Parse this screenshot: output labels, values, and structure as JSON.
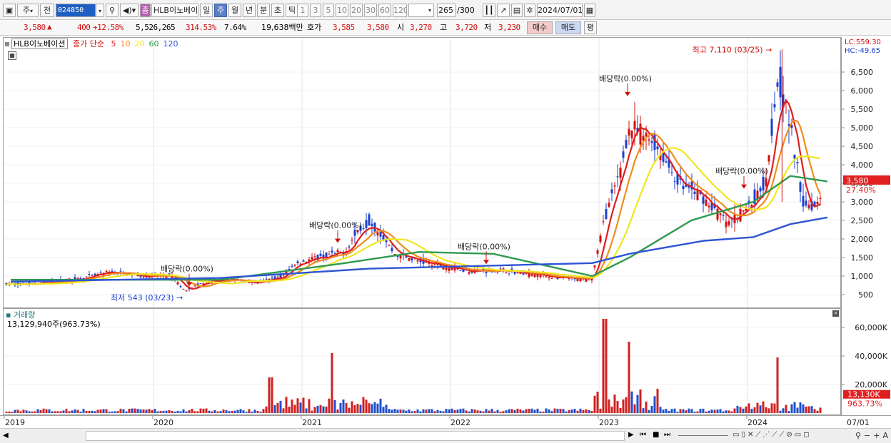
{
  "toolbar": {
    "type_button": "주",
    "prev_label": "전",
    "stock_code": "024850",
    "stock_name": "HLB이노베이",
    "period_buttons": [
      "일",
      "주",
      "월",
      "년",
      "분",
      "초",
      "틱"
    ],
    "selected_period": "주",
    "interval_buttons": [
      "1",
      "3",
      "5",
      "10",
      "20",
      "30",
      "60",
      "120"
    ],
    "count_value": "265",
    "count_total": "/300",
    "date_value": "2024/07/01"
  },
  "quote": {
    "price": "3,580",
    "change": "400",
    "change_pct": "+12.58%",
    "volume": "5,526,265",
    "volume_ratio": "314.53%",
    "turnover": "7.64%",
    "amount": "19,638백만",
    "bid_label": "호가",
    "ask": "3,585",
    "bid": "3,580",
    "open_label": "시",
    "open": "3,270",
    "high_label": "고",
    "high": "3,720",
    "low_label": "저",
    "low": "3,230",
    "buy_button": "매수",
    "sell_button": "매도",
    "eval_button": "평"
  },
  "price_pane": {
    "title": "HLB이노베이션",
    "legend_prefix": "종가 단순",
    "ma_labels": [
      "5",
      "10",
      "20",
      "60",
      "120"
    ],
    "ma_colors": [
      "#e01e1e",
      "#f08c1e",
      "#f0e61e",
      "#2e9a4e",
      "#2f55d4"
    ],
    "lc": "LC:559.30",
    "hc": "HC:-49.65",
    "last_price_label": "3,580",
    "last_change_label": "27.40%",
    "high_annotation": "최고 7,110 (03/25)",
    "low_annotation": "최저 543 (03/23)",
    "dividend_notes": [
      "배당락(0.00%)",
      "배당락(0.00%)",
      "배당락(0.00%)",
      "배당락(0.00%)",
      "배당락(0.00%)"
    ]
  },
  "volume_pane": {
    "title": "거래량",
    "value": "13,129,940주(963.73%)",
    "last_label": "13,130K",
    "last_pct": "963.73%"
  },
  "time_axis": {
    "labels": [
      "2019",
      "2020",
      "2021",
      "2022",
      "2023",
      "2024",
      "07/01"
    ]
  },
  "colors": {
    "up": "#d01010",
    "down": "#1a3fd1",
    "volume_up": "#d22020",
    "volume_down": "#1f4fcc"
  },
  "chart_data": {
    "type": "candlestick",
    "title": "HLB이노베이션",
    "x_range": [
      "2019",
      "2024/07/01"
    ],
    "ylim": [
      500,
      7000
    ],
    "y_ticks": [
      500,
      1000,
      1500,
      2000,
      2500,
      3000,
      3500,
      4000,
      4500,
      5000,
      5500,
      6000,
      6500
    ],
    "volume_ticks": [
      "20,000K",
      "40,000K",
      "60,000K"
    ],
    "close_path": [
      [
        "2019-01",
        780
      ],
      [
        "2019-04",
        820
      ],
      [
        "2019-07",
        950
      ],
      [
        "2019-09",
        1100
      ],
      [
        "2019-12",
        1000
      ],
      [
        "2020-02",
        1000
      ],
      [
        "2020-03",
        620
      ],
      [
        "2020-05",
        850
      ],
      [
        "2020-07",
        900
      ],
      [
        "2020-09",
        820
      ],
      [
        "2020-11",
        1000
      ],
      [
        "2020-12",
        1350
      ],
      [
        "2021-02",
        1500
      ],
      [
        "2021-04",
        1650
      ],
      [
        "2021-05",
        2200
      ],
      [
        "2021-06",
        2500
      ],
      [
        "2021-07",
        2100
      ],
      [
        "2021-08",
        1600
      ],
      [
        "2021-10",
        1400
      ],
      [
        "2021-12",
        1250
      ],
      [
        "2022-02",
        1150
      ],
      [
        "2022-05",
        1150
      ],
      [
        "2022-08",
        1000
      ],
      [
        "2022-11",
        900
      ],
      [
        "2022-12",
        950
      ],
      [
        "2023-01",
        2600
      ],
      [
        "2023-02",
        3500
      ],
      [
        "2023-03",
        5000
      ],
      [
        "2023-05",
        4600
      ],
      [
        "2023-07",
        3500
      ],
      [
        "2023-09",
        3100
      ],
      [
        "2023-11",
        2400
      ],
      [
        "2024-01",
        3000
      ],
      [
        "2024-02",
        3600
      ],
      [
        "2024-03",
        6400
      ],
      [
        "2024-04",
        5000
      ],
      [
        "2024-05",
        3000
      ],
      [
        "2024-06",
        2900
      ],
      [
        "2024-07",
        3580
      ]
    ],
    "ma120_path": [
      [
        "2019-01",
        850
      ],
      [
        "2020-06",
        950
      ],
      [
        "2021-06",
        1200
      ],
      [
        "2022-06",
        1300
      ],
      [
        "2022-12",
        1350
      ],
      [
        "2023-03",
        1600
      ],
      [
        "2023-09",
        1950
      ],
      [
        "2024-01",
        2050
      ],
      [
        "2024-04",
        2400
      ],
      [
        "2024-07",
        2580
      ]
    ],
    "ma60_path": [
      [
        "2019-01",
        900
      ],
      [
        "2020-06",
        900
      ],
      [
        "2021-04",
        1350
      ],
      [
        "2021-10",
        1650
      ],
      [
        "2022-04",
        1600
      ],
      [
        "2022-12",
        1000
      ],
      [
        "2023-03",
        1500
      ],
      [
        "2023-08",
        2500
      ],
      [
        "2024-01",
        3000
      ],
      [
        "2024-04",
        3700
      ],
      [
        "2024-07",
        3550
      ]
    ],
    "high": {
      "date": "2024-03-25",
      "value": 7110
    },
    "low": {
      "date": "2020-03-23",
      "value": 543
    },
    "last": {
      "value": 3580,
      "change_pct": "27.40%"
    },
    "volume_highlights_k": [
      [
        "2020-10",
        25000
      ],
      [
        "2021-03",
        42000
      ],
      [
        "2023-01",
        66000
      ],
      [
        "2023-03",
        50000
      ],
      [
        "2024-03",
        39000
      ],
      [
        "2024-07",
        13130
      ]
    ]
  }
}
